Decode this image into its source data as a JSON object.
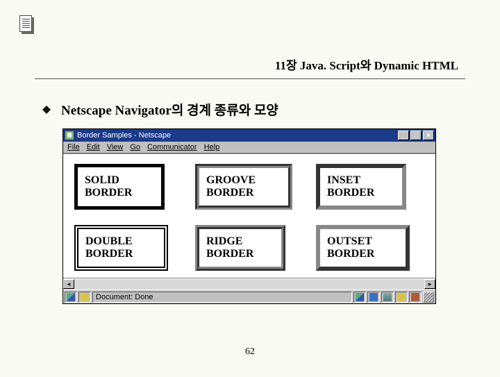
{
  "chapter_title": "11장 Java. Script와 Dynamic HTML",
  "bullet": "Netscape Navigator의 경계 종류와 모양",
  "window": {
    "title": "Border Samples - Netscape",
    "min_glyph": "_",
    "max_glyph": "□",
    "close_glyph": "×",
    "menu": [
      "File",
      "Edit",
      "View",
      "Go",
      "Communicator",
      "Help"
    ],
    "samples": [
      {
        "label_1": "SOLID",
        "label_2": "BORDER",
        "cls": "solid"
      },
      {
        "label_1": "GROOVE",
        "label_2": "BORDER",
        "cls": "groove"
      },
      {
        "label_1": "INSET",
        "label_2": "BORDER",
        "cls": "inset"
      },
      {
        "label_1": "DOUBLE",
        "label_2": "BORDER",
        "cls": "double"
      },
      {
        "label_1": "RIDGE",
        "label_2": "BORDER",
        "cls": "ridge"
      },
      {
        "label_1": "OUTSET",
        "label_2": "BORDER",
        "cls": "outset"
      }
    ],
    "scroll_left": "◂",
    "scroll_right": "▸",
    "status": "Document: Done"
  },
  "page_number": "62"
}
